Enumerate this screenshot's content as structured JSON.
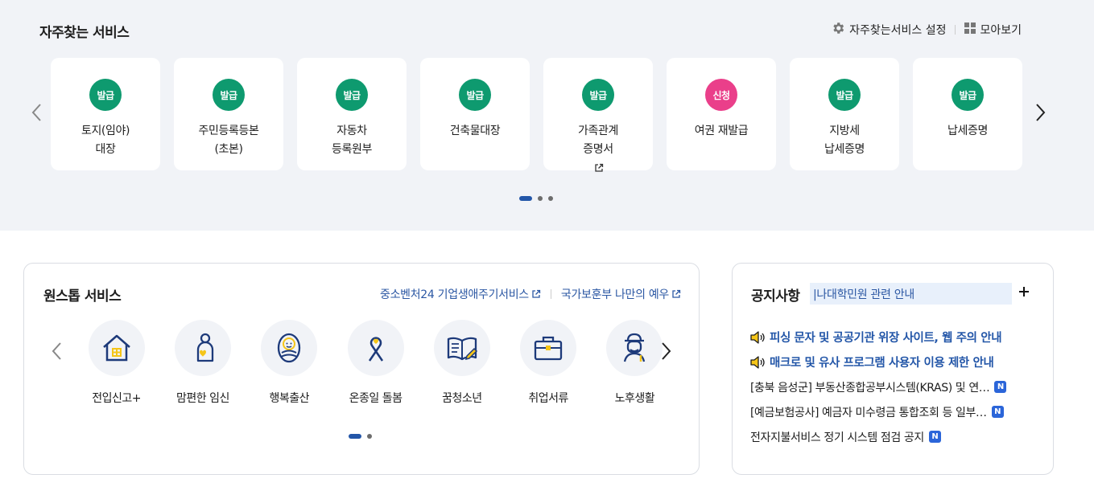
{
  "frequent": {
    "title": "자주찾는 서비스",
    "settings_label": "자주찾는서비스 설정",
    "view_all_label": "모아보기",
    "cards": [
      {
        "badge": "발급",
        "line1": "토지(임야)",
        "line2": "대장",
        "badge_color": "#0e9a6f"
      },
      {
        "badge": "발급",
        "line1": "주민등록등본",
        "line2": "(초본)",
        "badge_color": "#0e9a6f"
      },
      {
        "badge": "발급",
        "line1": "자동차",
        "line2": "등록원부",
        "badge_color": "#0e9a6f"
      },
      {
        "badge": "발급",
        "line1": "건축물대장",
        "line2": "",
        "badge_color": "#0e9a6f"
      },
      {
        "badge": "발급",
        "line1": "가족관계",
        "line2": "증명서",
        "badge_color": "#0e9a6f",
        "external": true
      },
      {
        "badge": "신청",
        "line1": "여권 재발급",
        "line2": "",
        "badge_color": "#ea3f8a"
      },
      {
        "badge": "발급",
        "line1": "지방세",
        "line2": "납세증명",
        "badge_color": "#0e9a6f"
      },
      {
        "badge": "발급",
        "line1": "납세증명",
        "line2": "",
        "badge_color": "#0e9a6f"
      }
    ],
    "page_count": 3,
    "active_page": 1
  },
  "onestop": {
    "title": "원스톱 서비스",
    "link1": "중소벤처24 기업생애주기서비스",
    "link2": "국가보훈부 나만의 예우",
    "items": [
      {
        "label": "전입신고+",
        "icon": "house-icon"
      },
      {
        "label": "맘편한 임신",
        "icon": "pregnancy-icon"
      },
      {
        "label": "행복출산",
        "icon": "baby-icon"
      },
      {
        "label": "온종일 돌봄",
        "icon": "care-ribbon-icon"
      },
      {
        "label": "꿈청소년",
        "icon": "book-icon"
      },
      {
        "label": "취업서류",
        "icon": "briefcase-icon"
      },
      {
        "label": "노후생활",
        "icon": "elder-icon"
      }
    ],
    "page_count": 2,
    "active_page": 1
  },
  "notice": {
    "title": "공지사항",
    "ticker": "|나대학민원 관련 안내",
    "items": [
      {
        "text": "피싱 문자 및 공공기관 위장 사이트, 웹 주의 안내",
        "highlight": true,
        "new": false
      },
      {
        "text": "매크로 및 유사 프로그램 사용자 이용 제한 안내",
        "highlight": true,
        "new": false
      },
      {
        "text": "[충북 음성군] 부동산종합공부시스템(KRAS) 및 연…",
        "highlight": false,
        "new": true
      },
      {
        "text": "[예금보험공사] 예금자 미수령금 통합조회 등 일부…",
        "highlight": false,
        "new": true
      },
      {
        "text": "전자지불서비스 정기 시스템 점검 공지",
        "highlight": false,
        "new": true
      }
    ],
    "new_badge": "N"
  },
  "colors": {
    "accent": "#2356a8",
    "issue_badge": "#0e9a6f",
    "apply_badge": "#ea3f8a",
    "icon_navy": "#1d3a7a",
    "icon_yellow": "#f5c518"
  }
}
